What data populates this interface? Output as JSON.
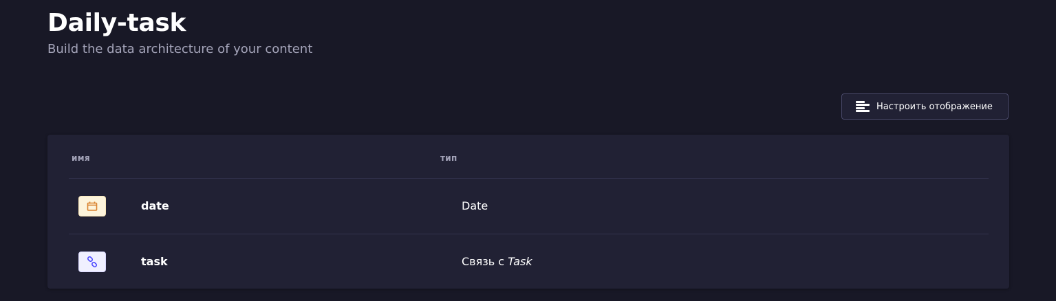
{
  "header": {
    "title": "Daily-task",
    "subtitle": "Build the data architecture of your content"
  },
  "toolbar": {
    "configure_label": "Настроить отображение",
    "configure_icon": "list-layout-icon"
  },
  "table": {
    "columns": [
      "имя",
      "тип"
    ],
    "rows": [
      {
        "name": "date",
        "type": "Date",
        "icon": "calendar-icon",
        "icon_color": "#d9822f",
        "icon_bg": "#fdf4dc"
      },
      {
        "name": "task",
        "type_prefix": "Связь с",
        "type_target": "Task",
        "icon": "relation-link-icon",
        "icon_color": "#4945ff",
        "icon_bg": "#f0f0ff"
      }
    ]
  },
  "colors": {
    "background": "#181826",
    "card": "#212134",
    "border": "#32324d",
    "muted_text": "#a5a5ba"
  }
}
